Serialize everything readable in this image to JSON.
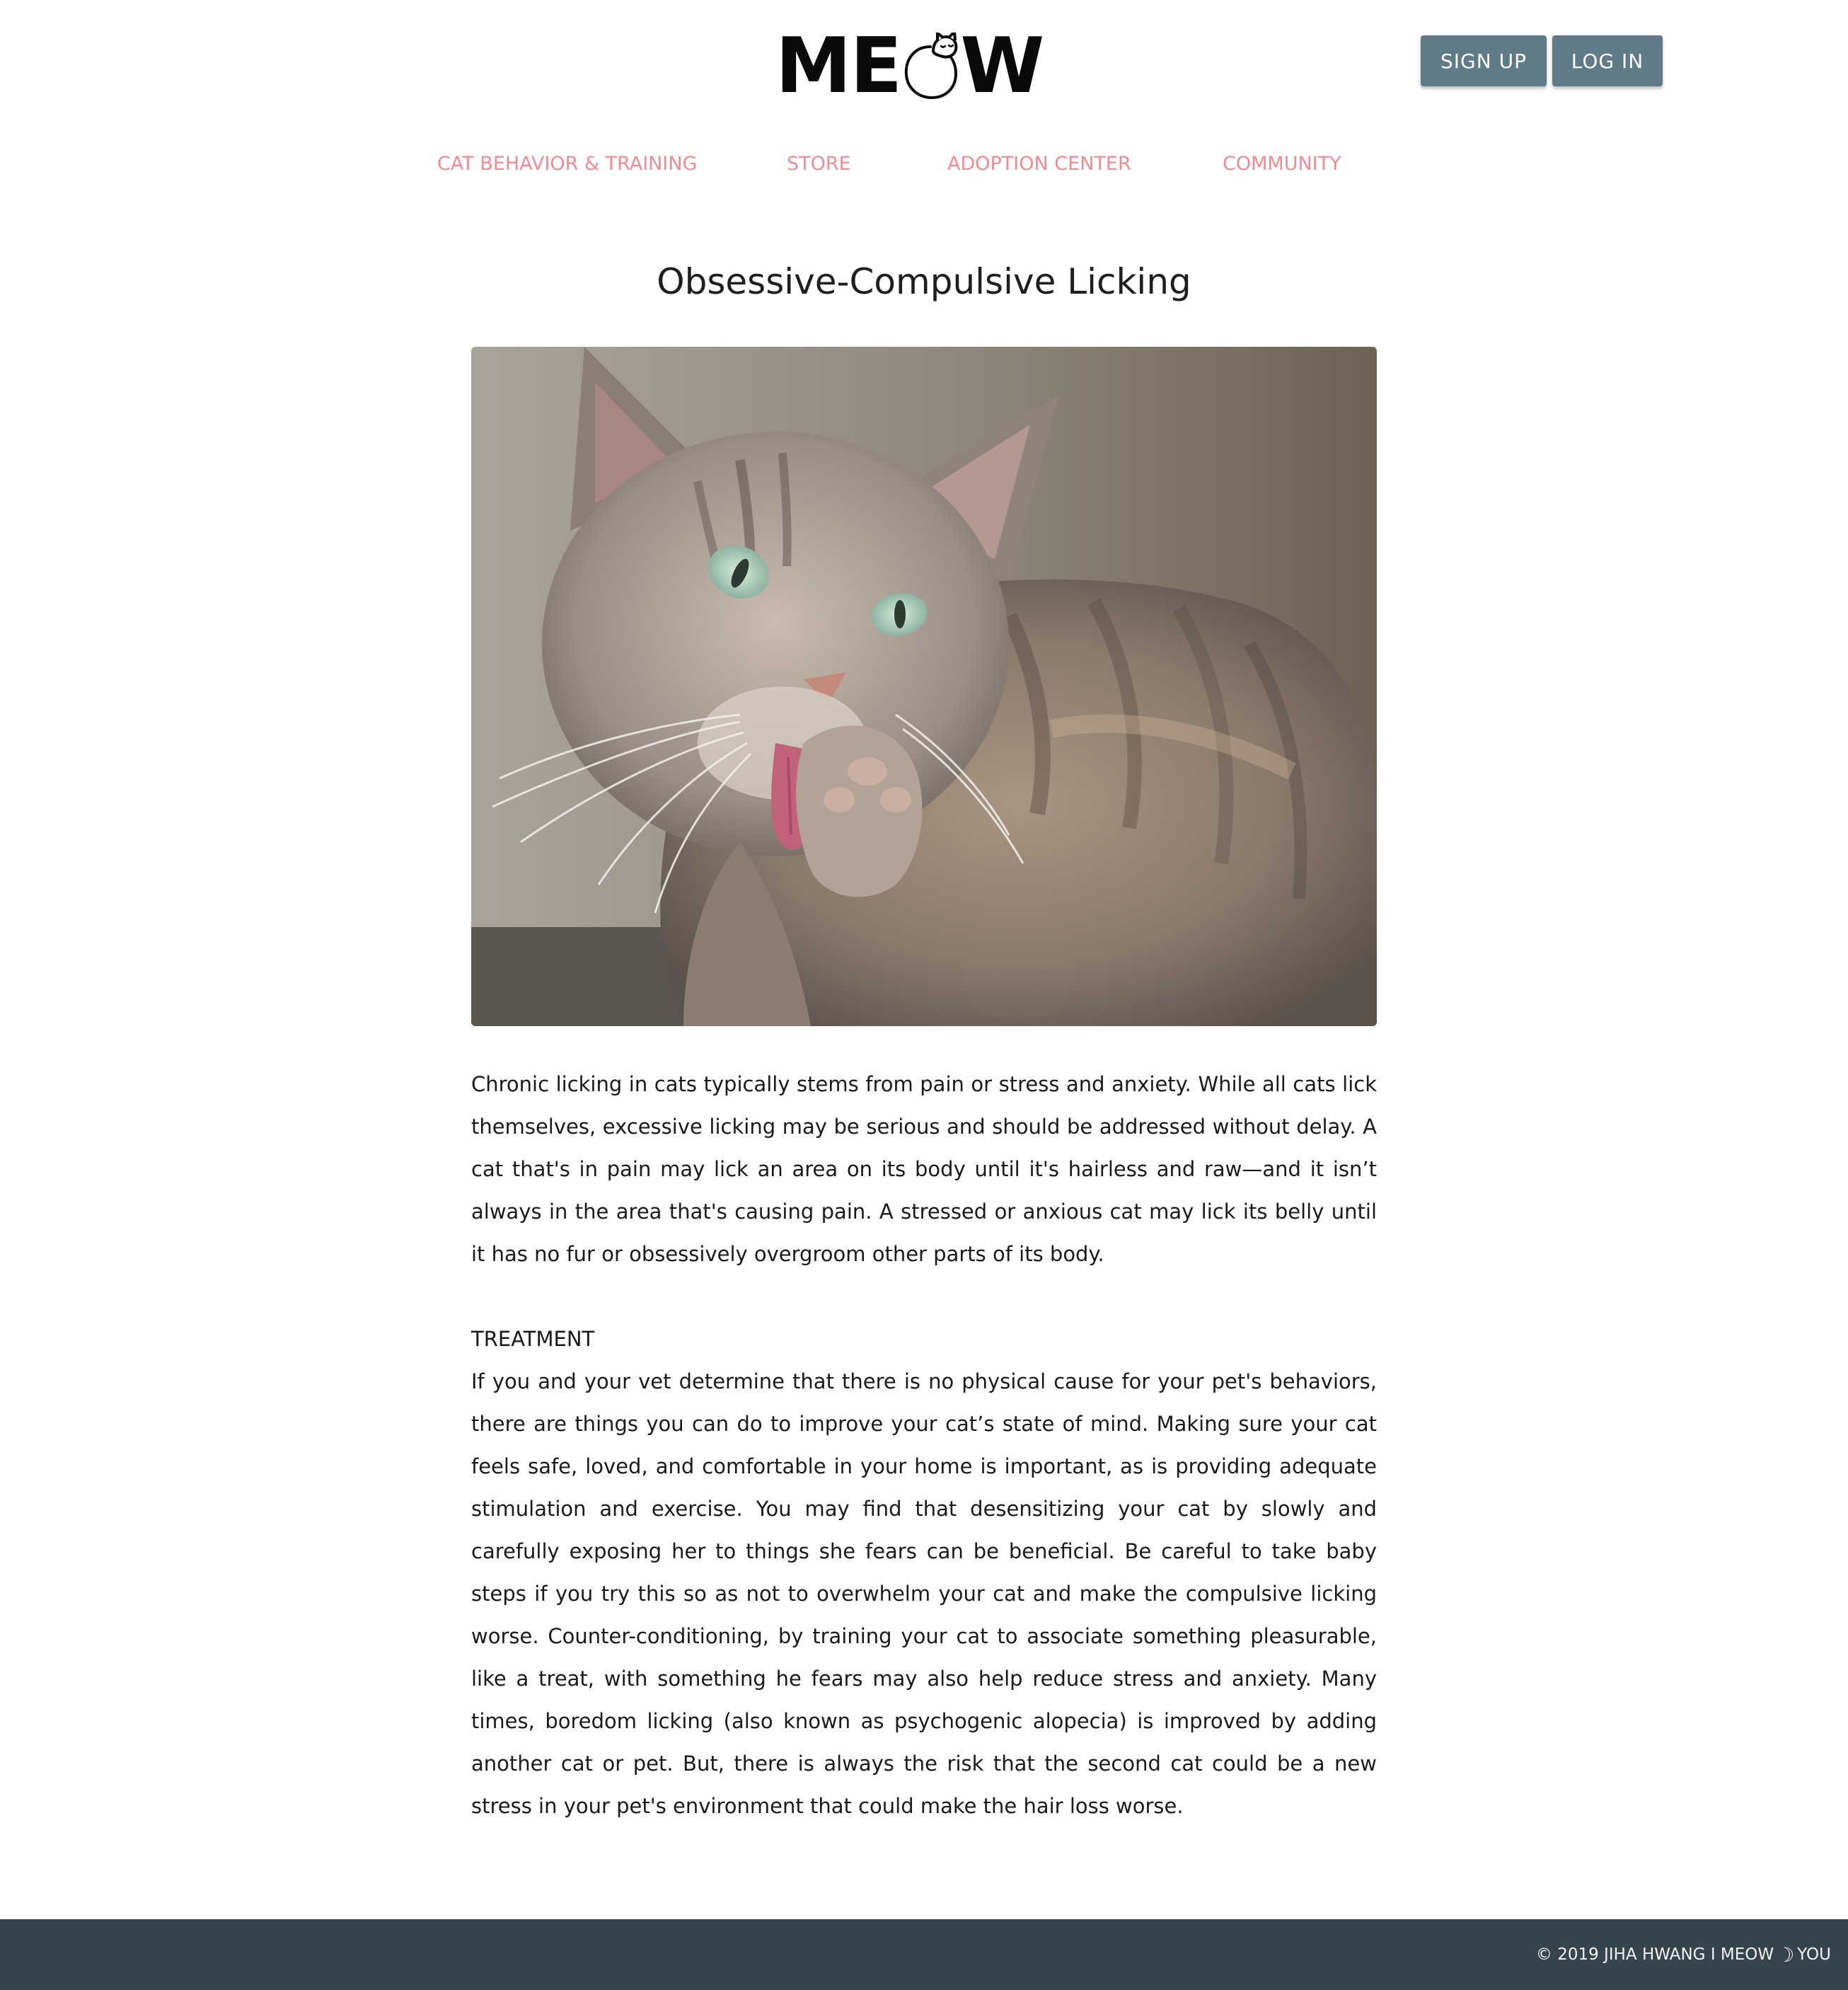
{
  "header": {
    "logo": {
      "left": "ME",
      "right": "W",
      "cat_icon": "sleeping-cat-icon"
    },
    "auth": {
      "signup_label": "SIGN UP",
      "login_label": "LOG IN"
    }
  },
  "nav": {
    "items": [
      {
        "label": "CAT BEHAVIOR & TRAINING"
      },
      {
        "label": "STORE"
      },
      {
        "label": "ADOPTION CENTER"
      },
      {
        "label": "COMMUNITY"
      }
    ]
  },
  "article": {
    "title": "Obsessive-Compulsive Licking",
    "paragraph1": "Chronic licking in cats typically stems from pain or stress and anxiety. While all cats lick themselves, excessive licking may be serious and should be addressed without delay. A cat that's in pain may lick an area on its body until it's hairless and raw—and it isn’t always in the area that's causing pain. A stressed or anxious cat may lick its belly until it has no fur or obsessively overgroom other parts of its body.",
    "treatment_heading": "TREATMENT",
    "paragraph2": "If you and your vet determine that there is no physical cause for your pet's behaviors, there are things you can do to improve your cat’s state of mind. Making sure your cat feels safe, loved, and comfortable in your home is important, as is providing adequate stimulation and exercise. You may find that desensitizing your cat by slowly and carefully exposing her to things she fears can be beneficial. Be careful to take baby steps if you try this so as not to overwhelm your cat and make the compulsive licking worse. Counter-conditioning, by training your cat to associate something pleasurable, like a treat, with something he fears may also help reduce stress and anxiety. Many times, boredom licking (also known as psychogenic alopecia) is improved by adding another cat or pet. But, there is always the risk that the second cat could be a new stress in your pet's environment that could make the hair loss worse."
  },
  "footer": {
    "copyright": "© 2019 JIHA HWANG",
    "brand": "I MEOW",
    "brand_icon": "moon-icon",
    "suffix": "YOU"
  },
  "colors": {
    "nav_link": "#f08b93",
    "button_bg": "#5f7b87",
    "footer_bg": "#36444d"
  }
}
